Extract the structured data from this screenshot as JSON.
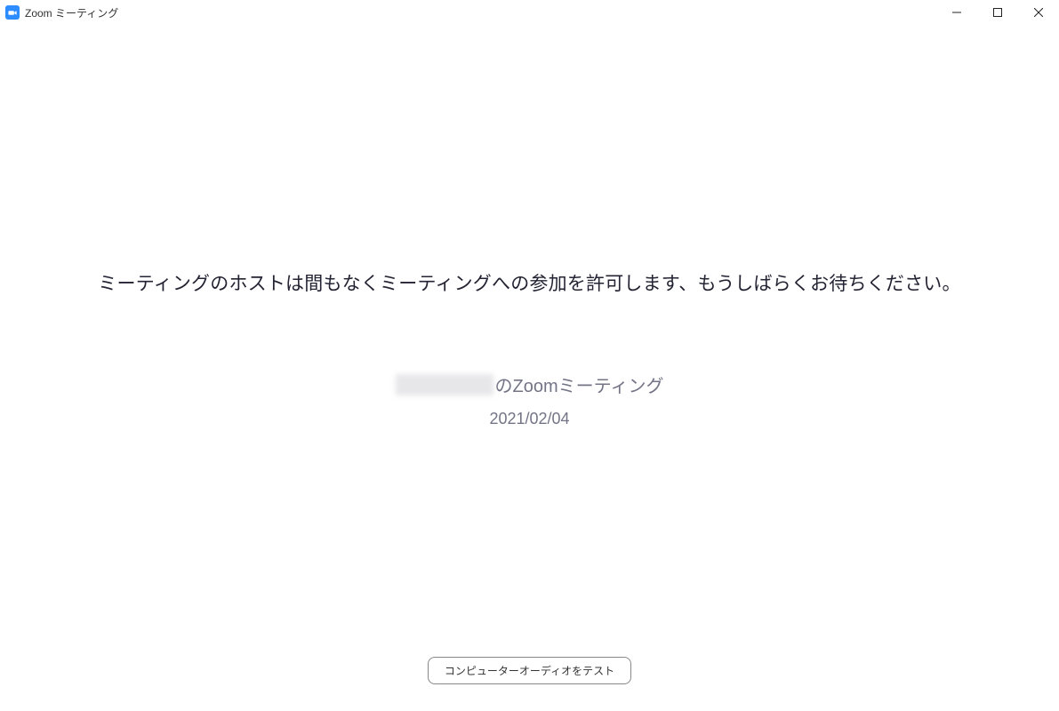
{
  "titlebar": {
    "title": "Zoom ミーティング"
  },
  "main": {
    "waiting_message": "ミーティングのホストは間もなくミーティングへの参加を許可します、もうしばらくお待ちください。",
    "meeting_title_suffix": "のZoomミーティング",
    "meeting_date": "2021/02/04"
  },
  "footer": {
    "test_audio_label": "コンピューターオーディオをテスト"
  }
}
